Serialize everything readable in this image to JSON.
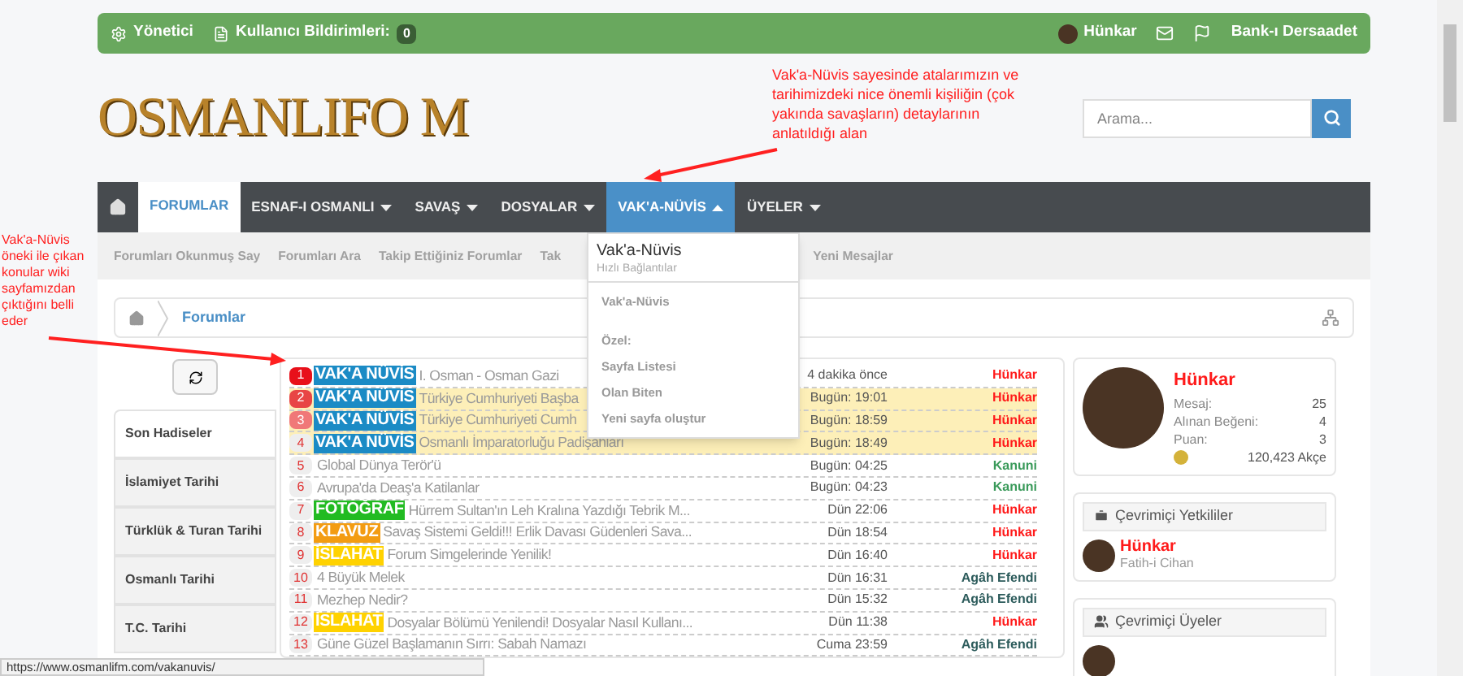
{
  "top_bar": {
    "admin": "Yönetici",
    "reports_label": "Kullanıcı Bildirimleri:",
    "reports_count": "0",
    "user": "Hünkar",
    "bank": "Bank-ı Dersaadet"
  },
  "logo": "OSMANLIFO M",
  "search": {
    "placeholder": "Arama..."
  },
  "annotations": [
    {
      "text": "Vak'a-Nüvis sayesinde atalarımızın ve tarihimizdeki nice önemli kişiliğin (çok yakında savaşların) detaylarının anlatıldığı alan"
    },
    {
      "text": "Vak'a-Nüvis öneki ile çıkan konular wiki sayfamızdan çıktığını belli eder"
    }
  ],
  "nav": [
    {
      "label": "FORUMLAR",
      "selected": true,
      "has_menu": false,
      "open": false
    },
    {
      "label": "ESNAF-I OSMANLI",
      "selected": false,
      "has_menu": true,
      "open": false
    },
    {
      "label": "SAVAŞ",
      "selected": false,
      "has_menu": true,
      "open": false
    },
    {
      "label": "DOSYALAR",
      "selected": false,
      "has_menu": true,
      "open": false
    },
    {
      "label": "VAK'A-NÜVİS",
      "selected": false,
      "has_menu": true,
      "open": true
    },
    {
      "label": "ÜYELER",
      "selected": false,
      "has_menu": true,
      "open": false
    }
  ],
  "subnav": [
    "Forumları Okunmuş Say",
    "Forumları Ara",
    "Takip Ettiğiniz Forumlar",
    "Tak",
    "Yeni Mesajlar"
  ],
  "dropdown": {
    "title": "Vak'a-Nüvis",
    "subtitle": "Hızlı Bağlantılar",
    "items": [
      {
        "kind": "link",
        "text": "Vak'a-Nüvis"
      },
      {
        "kind": "heading",
        "text": "Özel:"
      },
      {
        "kind": "link",
        "text": "Sayfa Listesi"
      },
      {
        "kind": "link",
        "text": "Olan Biten"
      },
      {
        "kind": "link",
        "text": "Yeni sayfa oluştur"
      }
    ]
  },
  "breadcrumb": [
    "Forumlar"
  ],
  "tabs": [
    {
      "label": "Son Hadiseler",
      "selected": true
    },
    {
      "label": "İslamiyet Tarihi",
      "selected": false
    },
    {
      "label": "Türklük & Turan Tarihi",
      "selected": false
    },
    {
      "label": "Osmanlı Tarihi",
      "selected": false
    },
    {
      "label": "T.C. Tarihi",
      "selected": false
    }
  ],
  "threads": [
    {
      "number": {
        "text": "1",
        "color": "#e8101a"
      },
      "prefix": {
        "text": "VAK'A NÜVİS",
        "color": "#1b8bc5"
      },
      "title": "I. Osman - Osman Gazi",
      "time": "4 dakika önce",
      "user": {
        "text": "Hünkar",
        "color": "#ff1a1a"
      },
      "highlighted": false
    },
    {
      "number": {
        "text": "2",
        "color": "#e84545"
      },
      "prefix": {
        "text": "VAK'A NÜVİS",
        "color": "#1b8bc5"
      },
      "title": "Türkiye Cumhuriyeti Başba",
      "time": "Bugün: 19:01",
      "user": {
        "text": "Hünkar",
        "color": "#ff1a1a"
      },
      "highlighted": true
    },
    {
      "number": {
        "text": "3",
        "color": "#f07878"
      },
      "prefix": {
        "text": "VAK'A NÜVİS",
        "color": "#1b8bc5"
      },
      "title": "Türkiye Cumhuriyeti Cumh",
      "time": "Bugün: 18:59",
      "user": {
        "text": "Hünkar",
        "color": "#ff1a1a"
      },
      "highlighted": true
    },
    {
      "number": {
        "text": "4",
        "color": "#eeeeee"
      },
      "prefix": {
        "text": "VAK'A NÜVİS",
        "color": "#1b8bc5"
      },
      "title": "Osmanlı İmparatorluğu Padişahları",
      "time": "Bugün: 18:49",
      "user": {
        "text": "Hünkar",
        "color": "#ff1a1a"
      },
      "highlighted": true
    },
    {
      "number": {
        "text": "5",
        "color": "#eeeeee"
      },
      "title": "Global Dünya Terör'ü",
      "time": "Bugün: 04:25",
      "user": {
        "text": "Kanuni",
        "color": "#3a9a5a"
      },
      "highlighted": false
    },
    {
      "number": {
        "text": "6",
        "color": "#eeeeee"
      },
      "title": "Avrupa'da Deaş'a Katilanlar",
      "time": "Bugün: 04:23",
      "user": {
        "text": "Kanuni",
        "color": "#3a9a5a"
      },
      "highlighted": false
    },
    {
      "number": {
        "text": "7",
        "color": "#eeeeee"
      },
      "prefix": {
        "text": "FOTOĞRAF",
        "color": "#22bb22"
      },
      "title": "Hürrem Sultan'ın Leh Kralına Yazdığı Tebrik M...",
      "time": "Dün 22:06",
      "user": {
        "text": "Hünkar",
        "color": "#ff1a1a"
      },
      "highlighted": false
    },
    {
      "number": {
        "text": "8",
        "color": "#eeeeee"
      },
      "prefix": {
        "text": "KLAVUZ",
        "color": "#f39c12"
      },
      "title": "Savaş Sistemi Geldi!!! Erlik Davası Güdenleri Sava...",
      "time": "Dün 18:54",
      "user": {
        "text": "Hünkar",
        "color": "#ff1a1a"
      },
      "highlighted": false
    },
    {
      "number": {
        "text": "9",
        "color": "#eeeeee"
      },
      "prefix": {
        "text": "İSLAHAT",
        "color": "#ffd200"
      },
      "title": "Forum Simgelerinde Yenilik!",
      "time": "Dün 16:40",
      "user": {
        "text": "Hünkar",
        "color": "#ff1a1a"
      },
      "highlighted": false
    },
    {
      "number": {
        "text": "10",
        "color": "#eeeeee"
      },
      "title": "4 Büyük Melek",
      "time": "Dün 16:31",
      "user": {
        "text": "Agâh Efendi",
        "color": "#2c5b5b"
      },
      "highlighted": false
    },
    {
      "number": {
        "text": "11",
        "color": "#eeeeee"
      },
      "title": "Mezhep Nedir?",
      "time": "Dün 15:32",
      "user": {
        "text": "Agâh Efendi",
        "color": "#2c5b5b"
      },
      "highlighted": false
    },
    {
      "number": {
        "text": "12",
        "color": "#eeeeee"
      },
      "prefix": {
        "text": "İSLAHAT",
        "color": "#ffd200"
      },
      "title": "Dosyalar Bölümü Yenilendi! Dosyalar Nasıl Kullanı...",
      "time": "Dün 11:38",
      "user": {
        "text": "Hünkar",
        "color": "#ff1a1a"
      },
      "highlighted": false
    },
    {
      "number": {
        "text": "13",
        "color": "#eeeeee"
      },
      "title": "Güne Güzel Başlamanın Sırrı: Sabah Namazı",
      "time": "Cuma 23:59",
      "user": {
        "text": "Agâh Efendi",
        "color": "#2c5b5b"
      },
      "highlighted": false
    }
  ],
  "profile": {
    "name": "Hünkar",
    "stats": [
      {
        "label": "Mesaj:",
        "value": "25"
      },
      {
        "label": "Alınan Beğeni:",
        "value": "4"
      },
      {
        "label": "Puan:",
        "value": "3"
      }
    ],
    "money": "120,423 Akçe"
  },
  "staff": {
    "title": "Çevrimiçi Yetkililer",
    "members": [
      {
        "name": "Hünkar",
        "role": "Fatih-i Cihan"
      }
    ]
  },
  "members": {
    "title": "Çevrimiçi Üyeler"
  },
  "status_bar": "https://www.osmanlifm.com/vakanuvis/"
}
